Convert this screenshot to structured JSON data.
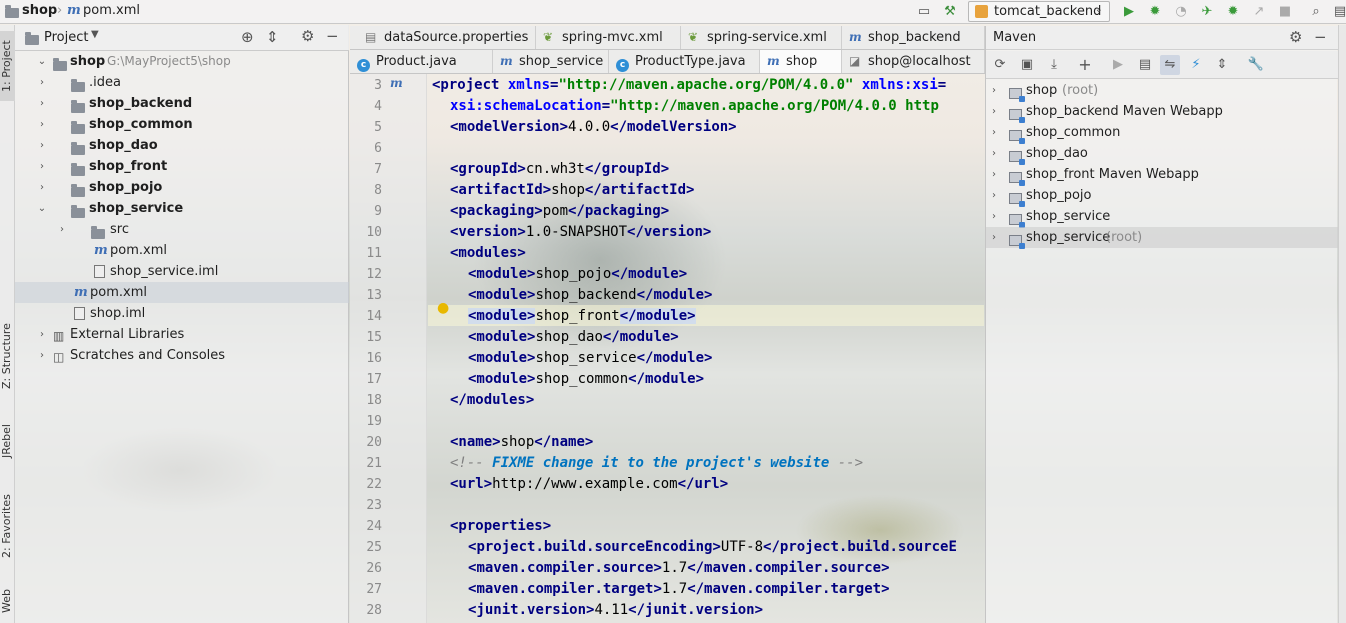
{
  "navbar": {
    "project_name": "shop",
    "file_name": "pom.xml",
    "run_config": "tomcat_backend"
  },
  "left_strip": {
    "project_tab": "1: Project",
    "structure_tab": "Z: Structure",
    "jrebel_tab": "JRebel",
    "favorites_tab": "2: Favorites",
    "web_tab": "Web"
  },
  "project_panel": {
    "title": "Project",
    "tree": [
      {
        "label": "shop",
        "path": "G:\\MayProject5\\shop"
      },
      {
        "label": ".idea"
      },
      {
        "label": "shop_backend"
      },
      {
        "label": "shop_common"
      },
      {
        "label": "shop_dao"
      },
      {
        "label": "shop_front"
      },
      {
        "label": "shop_pojo"
      },
      {
        "label": "shop_service"
      },
      {
        "label": "src"
      },
      {
        "label": "pom.xml"
      },
      {
        "label": "shop_service.iml"
      },
      {
        "label": "pom.xml"
      },
      {
        "label": "shop.iml"
      },
      {
        "label": "External Libraries"
      },
      {
        "label": "Scratches and Consoles"
      }
    ]
  },
  "editor_tabs": {
    "row1": [
      "dataSource.properties",
      "spring-mvc.xml",
      "spring-service.xml",
      "shop_backend"
    ],
    "row2": [
      "Product.java",
      "shop_service",
      "ProductType.java",
      "shop",
      "shop@localhost"
    ]
  },
  "editor": {
    "line_numbers": [
      "3",
      "4",
      "5",
      "6",
      "7",
      "8",
      "9",
      "10",
      "11",
      "12",
      "13",
      "14",
      "15",
      "16",
      "17",
      "18",
      "19",
      "20",
      "21",
      "22",
      "23",
      "24",
      "25",
      "26",
      "27",
      "28"
    ],
    "l3_open": "<project ",
    "l3_attr": "xmlns",
    "l3_eq": "=",
    "l3_str": "\"http://maven.apache.org/POM/4.0.0\"",
    "l3_attr2": " xmlns:xsi",
    "l3_eq2": "=",
    "l4_attr": "xsi:schemaLocation",
    "l4_eq": "=",
    "l4_str": "\"http://maven.apache.org/POM/4.0.0 http",
    "modelVersion": "4.0.0",
    "groupId": "cn.wh3t",
    "artifactId": "shop",
    "packaging": "pom",
    "version": "1.0-SNAPSHOT",
    "modules": [
      "shop_pojo",
      "shop_backend",
      "shop_front",
      "shop_dao",
      "shop_service",
      "shop_common"
    ],
    "name": "shop",
    "comment_open": "<!-- ",
    "comment_todo": "FIXME change it to the project's website",
    "comment_close": " -->",
    "url": "http://www.example.com",
    "enc_key": "project.build.sourceEncoding",
    "enc_val": "UTF-8",
    "enc_close": "</project.build.sourceE",
    "src_key": "maven.compiler.source",
    "src_val": "1.7",
    "tgt_key": "maven.compiler.target",
    "tgt_val": "1.7",
    "junit_key": "junit.version",
    "junit_val": "4.11"
  },
  "maven_panel": {
    "title": "Maven",
    "items": [
      {
        "label": "shop",
        "suffix": "(root)"
      },
      {
        "label": "shop_backend Maven Webapp",
        "suffix": ""
      },
      {
        "label": "shop_common",
        "suffix": ""
      },
      {
        "label": "shop_dao",
        "suffix": ""
      },
      {
        "label": "shop_front Maven Webapp",
        "suffix": ""
      },
      {
        "label": "shop_pojo",
        "suffix": ""
      },
      {
        "label": "shop_service",
        "suffix": ""
      },
      {
        "label": "shop_service",
        "suffix": "(root)"
      }
    ]
  },
  "colors": {
    "xml_tag": "#000080",
    "xml_attr": "#0000ff",
    "xml_string": "#008000",
    "comment": "#808080",
    "selection": "#c8d7f5"
  }
}
